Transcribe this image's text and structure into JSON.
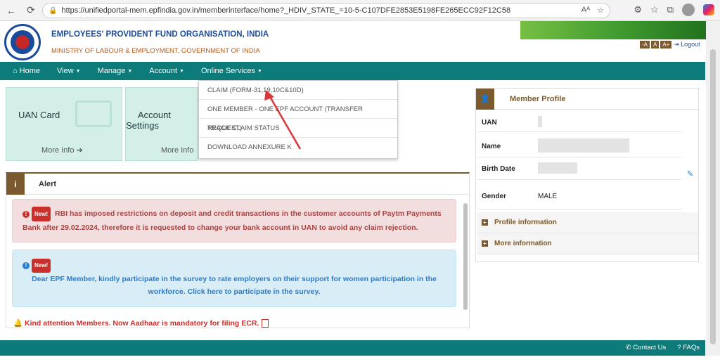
{
  "browser": {
    "url": "https://unifiedportal-mem.epfindia.gov.in/memberinterface/home?_HDIV_STATE_=10-5-C107DFE2853E5198FE265ECC92F12C58",
    "icons": [
      "back-arrow-icon",
      "refresh-icon",
      "lock-icon",
      "read-aloud-icon",
      "favorite-star-icon",
      "extensions-icon",
      "favorites-icon",
      "collections-icon",
      "profile-avatar",
      "copilot-icon"
    ]
  },
  "header": {
    "org_name": "EMPLOYEES' PROVIDENT FUND ORGANISATION, INDIA",
    "ministry": "MINISTRY OF LABOUR & EMPLOYMENT, GOVERNMENT OF INDIA",
    "font_sizes": [
      "-A",
      "A",
      "A+"
    ],
    "logout": "Logout"
  },
  "nav": {
    "home": "Home",
    "view": "View",
    "manage": "Manage",
    "account": "Account",
    "online_services": "Online Services"
  },
  "cards": [
    {
      "title_line1": "UAN Card",
      "title_line2": "",
      "more": "More Info"
    },
    {
      "title_line1": "Account",
      "title_line2": "Settings",
      "more": "More Info"
    }
  ],
  "dropdown": {
    "items": [
      "CLAIM (FORM-31,19,10C&10D)",
      "ONE MEMBER - ONE EPF ACCOUNT (TRANSFER REQUEST)",
      "TRACK CLAIM STATUS",
      "DOWNLOAD ANNEXURE K"
    ]
  },
  "alert": {
    "title": "Alert",
    "new_label": "New!",
    "msg1": "RBI has imposed restrictions on deposit and credit transactions in the customer accounts of Paytm Payments Bank after 29.02.2024, therefore it is requested to change your bank account in UAN to avoid any claim rejection.",
    "msg2": "Dear EPF Member, kindly participate in the survey to rate employers on their support for women participation in the workforce. Click here to participate in the survey.",
    "kind_attention": "Kind attention Members. Now Aadhaar is mandatory for filing ECR."
  },
  "profile": {
    "title": "Member Profile",
    "uan_label": "UAN",
    "name_label": "Name",
    "birth_label": "Birth Date",
    "gender_label": "Gender",
    "gender_value": "MALE",
    "profile_info": "Profile information",
    "more_info": "More information"
  },
  "footer": {
    "contact": "Contact Us",
    "faqs": "FAQs"
  },
  "colors": {
    "teal": "#0e7b7b",
    "brown": "#7a5a2e",
    "arrow": "#d9353b"
  }
}
